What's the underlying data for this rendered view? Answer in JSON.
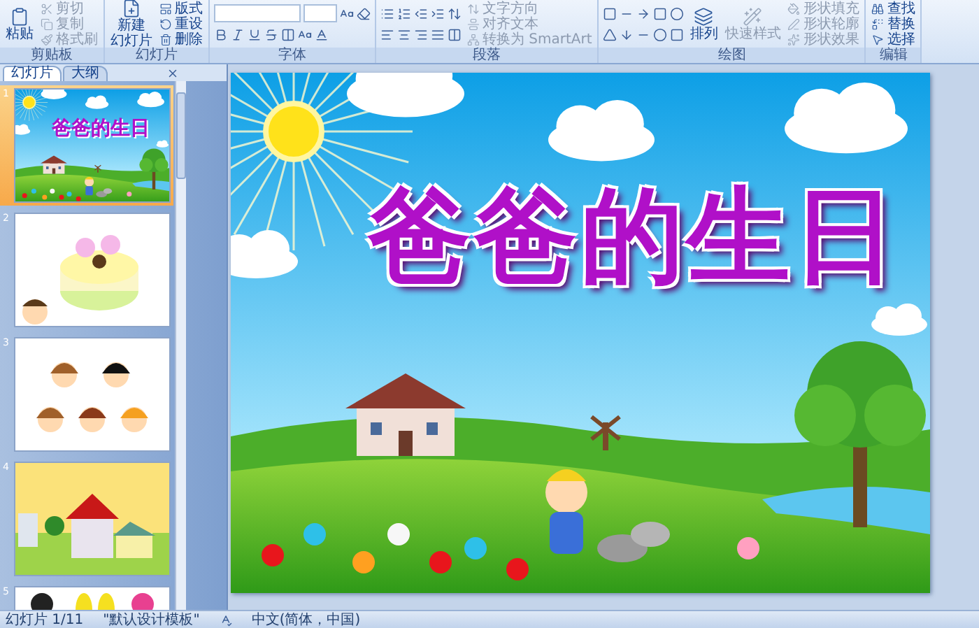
{
  "ribbon": {
    "groups": [
      {
        "kind": "clipboard",
        "label": "剪贴板",
        "large": [
          {
            "lines": [
              "粘贴"
            ],
            "disabled": false
          }
        ],
        "small": [
          {
            "label": "剪切",
            "disabled": true
          },
          {
            "label": "复制",
            "disabled": true
          },
          {
            "label": "格式刷",
            "disabled": true
          }
        ]
      },
      {
        "kind": "slides",
        "label": "幻灯片",
        "large": [
          {
            "lines": [
              "新建",
              "幻灯片"
            ],
            "disabled": false
          }
        ],
        "small": [
          {
            "label": "版式",
            "disabled": false
          },
          {
            "label": "重设",
            "disabled": false
          },
          {
            "label": "删除",
            "disabled": false
          }
        ]
      },
      {
        "kind": "font",
        "label": "字体"
      },
      {
        "kind": "paragraph",
        "label": "段落",
        "small": [
          {
            "label": "文字方向",
            "disabled": true
          },
          {
            "label": "对齐文本",
            "disabled": true
          },
          {
            "label": "转换为 SmartArt",
            "disabled": true
          }
        ]
      },
      {
        "kind": "drawing",
        "label": "绘图",
        "large": [
          {
            "lines": [
              "排列"
            ],
            "disabled": false
          },
          {
            "lines": [
              "快速样式"
            ],
            "disabled": true
          }
        ],
        "small": [
          {
            "label": "形状填充",
            "disabled": true
          },
          {
            "label": "形状轮廓",
            "disabled": true
          },
          {
            "label": "形状效果",
            "disabled": true
          }
        ]
      },
      {
        "kind": "editing",
        "label": "编辑",
        "small": [
          {
            "label": "查找",
            "disabled": false
          },
          {
            "label": "替换",
            "disabled": false
          },
          {
            "label": "选择",
            "disabled": false
          }
        ]
      }
    ]
  },
  "panel": {
    "tabs": [
      {
        "label": "幻灯片",
        "selected": true
      },
      {
        "label": "大纲",
        "selected": false
      }
    ],
    "thumbnails": [
      {
        "number": "1",
        "kind": "title",
        "title": "爸爸的生日",
        "selected": true
      },
      {
        "number": "2",
        "kind": "cake",
        "selected": false
      },
      {
        "number": "3",
        "kind": "faces",
        "selected": false
      },
      {
        "number": "4",
        "kind": "houses",
        "selected": false
      },
      {
        "number": "5",
        "kind": "sandals",
        "selected": false
      }
    ]
  },
  "slide": {
    "title": "爸爸的生日"
  },
  "status_bar": {
    "slide": "幻灯片 1/11",
    "theme": "\"默认设计模板\"",
    "language": "中文(简体，中国)"
  }
}
